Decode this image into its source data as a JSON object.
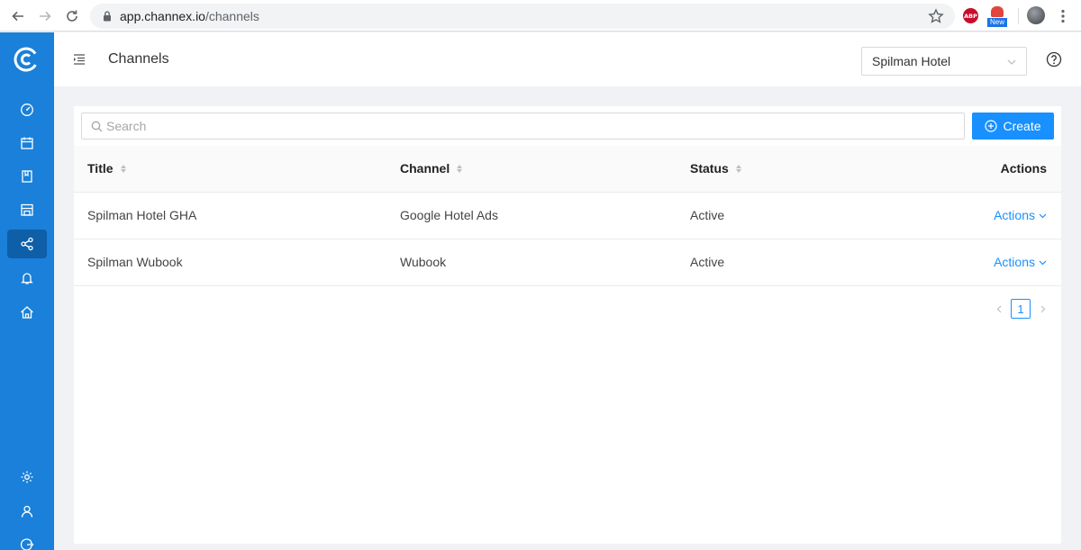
{
  "browser": {
    "url_domain": "app.channex.io",
    "url_path": "/channels",
    "abp_label": "ABP",
    "new_badge": "New"
  },
  "sidebar": {
    "items": [
      {
        "icon": "dashboard-icon"
      },
      {
        "icon": "calendar-icon"
      },
      {
        "icon": "bookmark-icon"
      },
      {
        "icon": "store-icon"
      },
      {
        "icon": "share-icon",
        "active": true
      },
      {
        "icon": "bell-icon"
      },
      {
        "icon": "home-icon"
      }
    ],
    "bottom_items": [
      {
        "icon": "gear-icon"
      },
      {
        "icon": "user-icon"
      },
      {
        "icon": "logout-icon"
      }
    ]
  },
  "header": {
    "title": "Channels",
    "property": "Spilman Hotel"
  },
  "search": {
    "placeholder": "Search",
    "value": ""
  },
  "create_label": "Create",
  "table": {
    "columns": [
      "Title",
      "Channel",
      "Status",
      "Actions"
    ],
    "rows": [
      {
        "title": "Spilman Hotel GHA",
        "channel": "Google Hotel Ads",
        "status": "Active",
        "action": "Actions"
      },
      {
        "title": "Spilman Wubook",
        "channel": "Wubook",
        "status": "Active",
        "action": "Actions"
      }
    ]
  },
  "pagination": {
    "current": "1"
  },
  "colors": {
    "sidebar": "#1a80d9",
    "primary": "#1890ff"
  }
}
